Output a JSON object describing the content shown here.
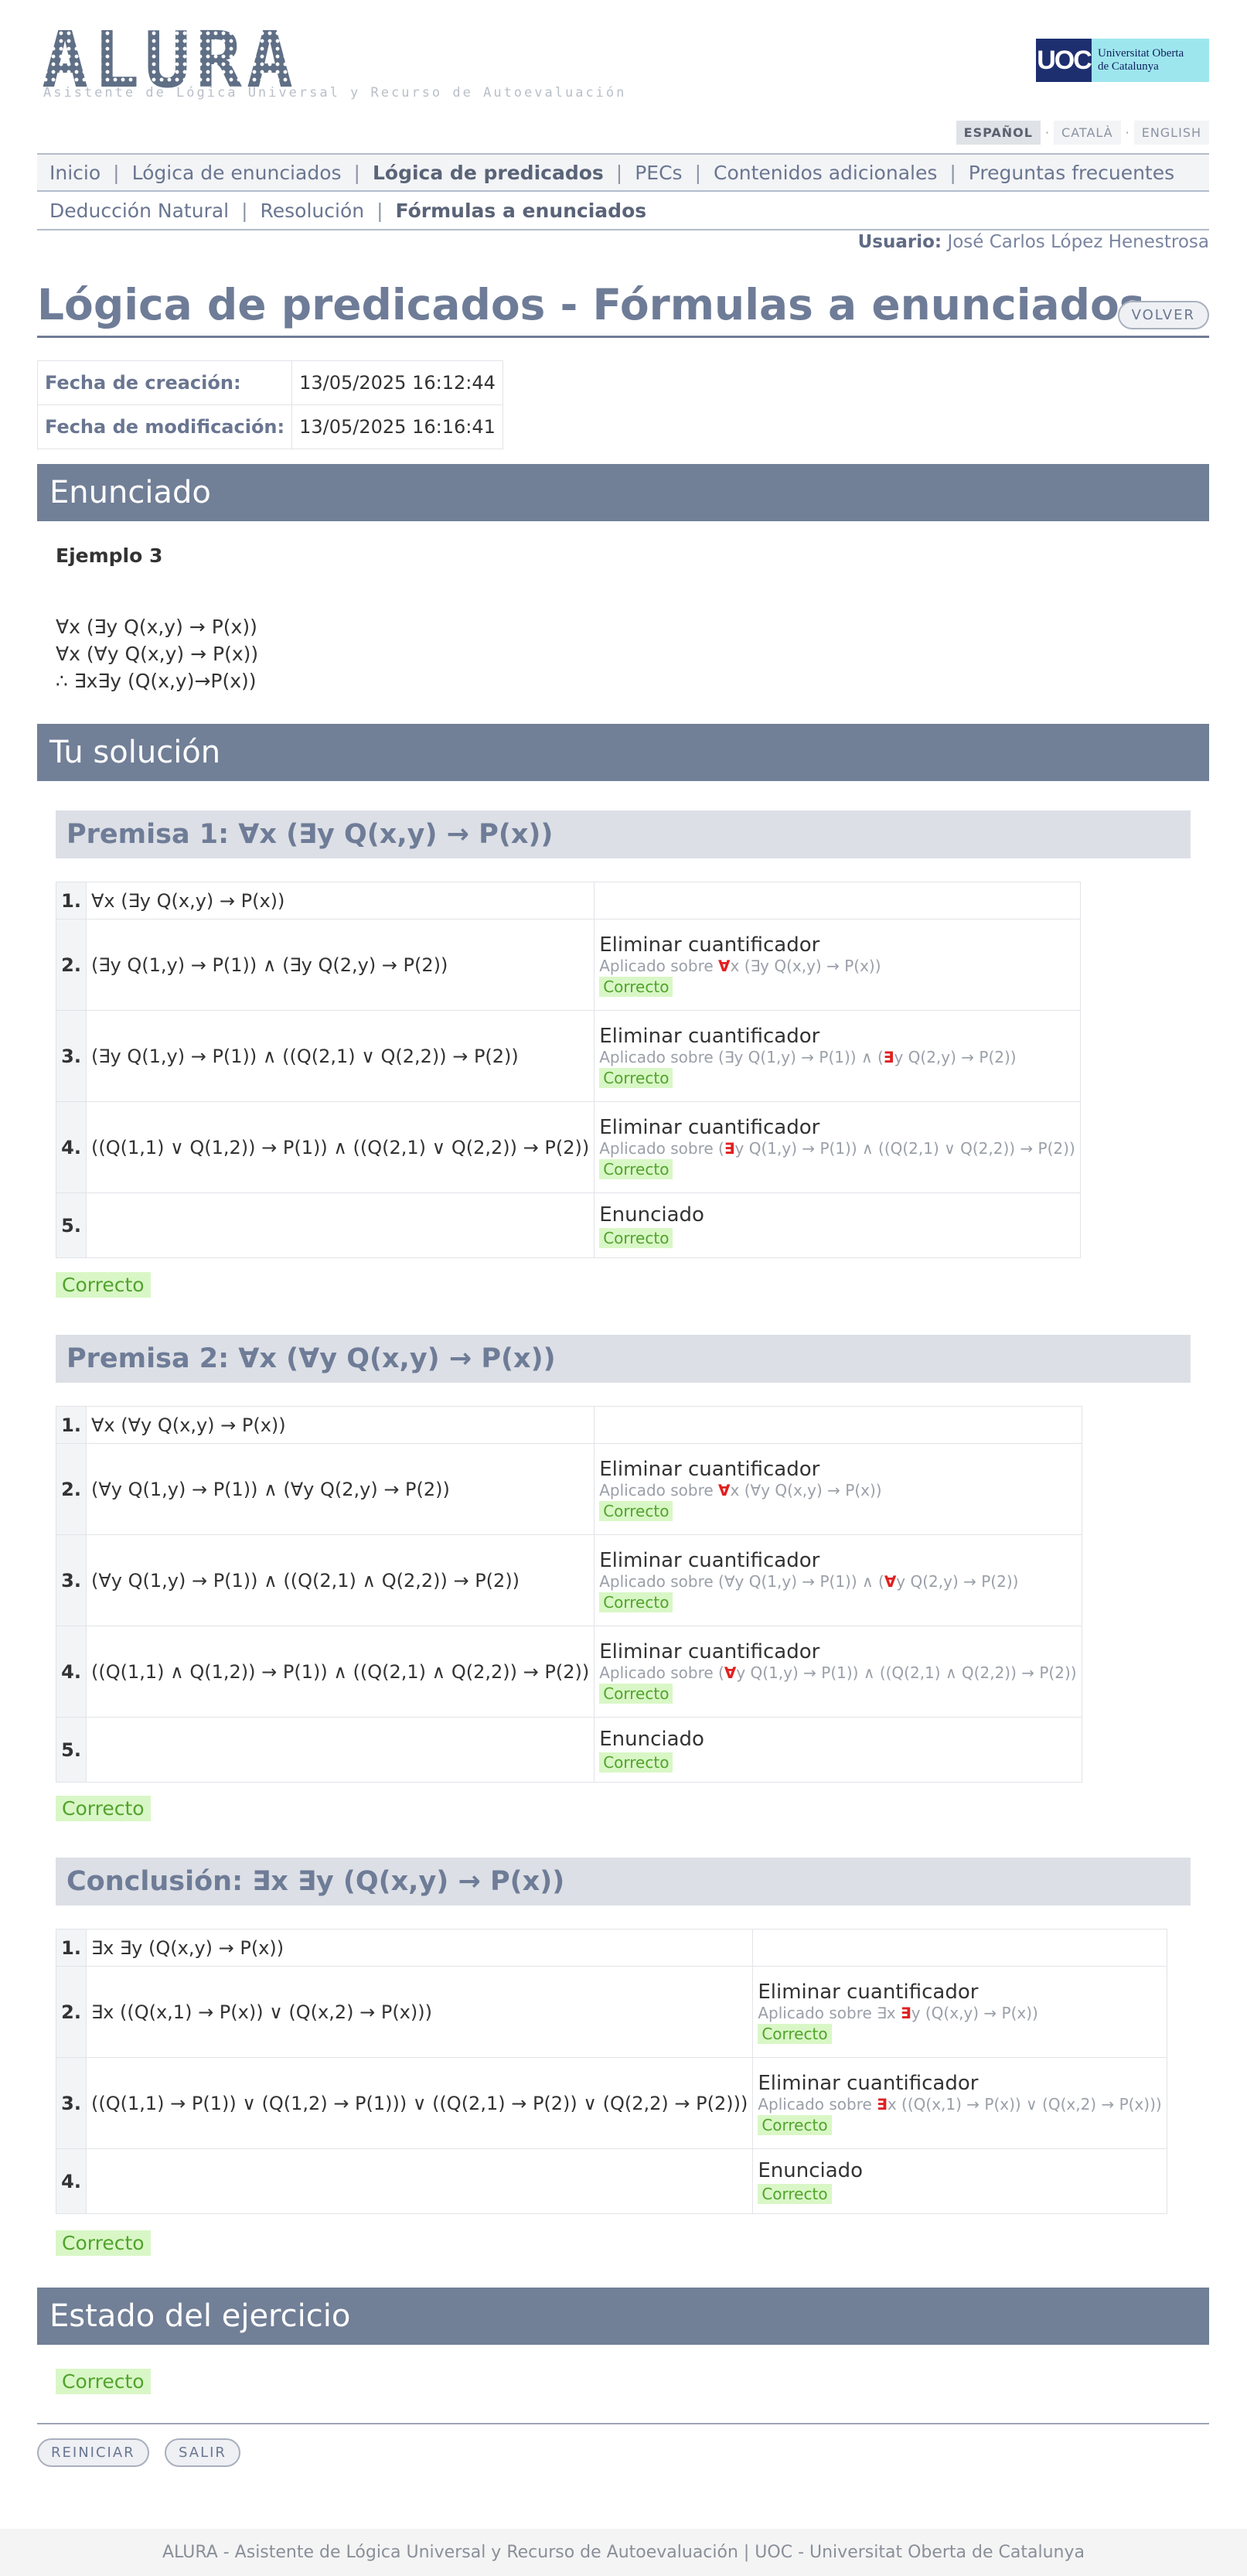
{
  "header": {
    "logo_text": "ALURA",
    "logo_subtitle": "Asistente de Lógica Universal y Recurso de Autoevaluación",
    "uoc_mark": "UOC",
    "uoc_name_line1": "Universitat Oberta",
    "uoc_name_line2": "de Catalunya",
    "languages": [
      "ESPAÑOL",
      "CATALÀ",
      "ENGLISH"
    ],
    "active_language": "ESPAÑOL"
  },
  "menu": {
    "primary": [
      "Inicio",
      "Lógica de enunciados",
      "Lógica de predicados",
      "PECs",
      "Contenidos adicionales",
      "Preguntas frecuentes"
    ],
    "primary_active": "Lógica de predicados",
    "secondary": [
      "Deducción Natural",
      "Resolución",
      "Fórmulas a enunciados"
    ],
    "secondary_active": "Fórmulas a enunciados"
  },
  "user": {
    "label": "Usuario:",
    "name": "José Carlos López Henestrosa"
  },
  "page_title": "Lógica de predicados - Fórmulas a enunciados",
  "volver_label": "VOLVER",
  "dates": {
    "created_label": "Fecha de creación:",
    "created_value": "13/05/2025 16:12:44",
    "modified_label": "Fecha de modificación:",
    "modified_value": "13/05/2025 16:16:41"
  },
  "enunciado": {
    "heading": "Enunciado",
    "example": "Ejemplo 3",
    "lines": [
      "∀x (∃y Q(x,y) → P(x))",
      "∀x (∀y Q(x,y) → P(x))",
      "∴ ∃x∃y (Q(x,y)→P(x))"
    ]
  },
  "solution_heading": "Tu solución",
  "sections": [
    {
      "title": "Premisa 1: ∀x (∃y Q(x,y) → P(x))",
      "steps": [
        {
          "n": "1.",
          "formula": "∀x (∃y Q(x,y) → P(x))"
        },
        {
          "n": "2.",
          "formula": "(∃y Q(1,y) → P(1)) ∧ (∃y Q(2,y) → P(2))",
          "rule": "Eliminar cuantificador",
          "applied_prefix": "Aplicado sobre",
          "applied_pre": "",
          "applied_hl": "∀",
          "applied_post": "x (∃y Q(x,y) → P(x))",
          "status": "Correcto"
        },
        {
          "n": "3.",
          "formula": "(∃y Q(1,y) → P(1)) ∧ ((Q(2,1) ∨ Q(2,2)) → P(2))",
          "rule": "Eliminar cuantificador",
          "applied_prefix": "Aplicado sobre",
          "applied_pre": "(∃y Q(1,y) → P(1)) ∧ (",
          "applied_hl": "∃",
          "applied_post": "y Q(2,y) → P(2))",
          "status": "Correcto"
        },
        {
          "n": "4.",
          "formula": "((Q(1,1) ∨ Q(1,2)) → P(1)) ∧ ((Q(2,1) ∨ Q(2,2)) → P(2))",
          "rule": "Eliminar cuantificador",
          "applied_prefix": "Aplicado sobre",
          "applied_pre": "(",
          "applied_hl": "∃",
          "applied_post": "y Q(1,y) → P(1)) ∧ ((Q(2,1) ∨ Q(2,2)) → P(2))",
          "status": "Correcto"
        },
        {
          "n": "5.",
          "formula": "",
          "rule": "Enunciado",
          "status": "Correcto"
        }
      ],
      "result": "Correcto"
    },
    {
      "title": "Premisa 2: ∀x (∀y Q(x,y) → P(x))",
      "steps": [
        {
          "n": "1.",
          "formula": "∀x (∀y Q(x,y) → P(x))"
        },
        {
          "n": "2.",
          "formula": "(∀y Q(1,y) → P(1)) ∧ (∀y Q(2,y) → P(2))",
          "rule": "Eliminar cuantificador",
          "applied_prefix": "Aplicado sobre",
          "applied_pre": "",
          "applied_hl": "∀",
          "applied_post": "x (∀y Q(x,y) → P(x))",
          "status": "Correcto"
        },
        {
          "n": "3.",
          "formula": "(∀y Q(1,y) → P(1)) ∧ ((Q(2,1) ∧ Q(2,2)) → P(2))",
          "rule": "Eliminar cuantificador",
          "applied_prefix": "Aplicado sobre",
          "applied_pre": "(∀y Q(1,y) → P(1)) ∧ (",
          "applied_hl": "∀",
          "applied_post": "y Q(2,y) → P(2))",
          "status": "Correcto"
        },
        {
          "n": "4.",
          "formula": "((Q(1,1) ∧ Q(1,2)) → P(1)) ∧ ((Q(2,1) ∧ Q(2,2)) → P(2))",
          "rule": "Eliminar cuantificador",
          "applied_prefix": "Aplicado sobre",
          "applied_pre": "(",
          "applied_hl": "∀",
          "applied_post": "y Q(1,y) → P(1)) ∧ ((Q(2,1) ∧ Q(2,2)) → P(2))",
          "status": "Correcto"
        },
        {
          "n": "5.",
          "formula": "",
          "rule": "Enunciado",
          "status": "Correcto"
        }
      ],
      "result": "Correcto"
    },
    {
      "title": "Conclusión: ∃x ∃y (Q(x,y) → P(x))",
      "steps": [
        {
          "n": "1.",
          "formula": "∃x ∃y (Q(x,y) → P(x))"
        },
        {
          "n": "2.",
          "formula": "∃x ((Q(x,1) → P(x)) ∨ (Q(x,2) → P(x)))",
          "rule": "Eliminar cuantificador",
          "applied_prefix": "Aplicado sobre",
          "applied_pre": "∃x ",
          "applied_hl": "∃",
          "applied_post": "y (Q(x,y) → P(x))",
          "status": "Correcto"
        },
        {
          "n": "3.",
          "formula": "((Q(1,1) → P(1)) ∨ (Q(1,2) → P(1))) ∨ ((Q(2,1) → P(2)) ∨ (Q(2,2) → P(2)))",
          "rule": "Eliminar cuantificador",
          "applied_prefix": "Aplicado sobre",
          "applied_pre": "",
          "applied_hl": "∃",
          "applied_post": "x ((Q(x,1) → P(x)) ∨ (Q(x,2) → P(x)))",
          "status": "Correcto"
        },
        {
          "n": "4.",
          "formula": "",
          "rule": "Enunciado",
          "status": "Correcto"
        }
      ],
      "result": "Correcto"
    }
  ],
  "estado": {
    "heading": "Estado del ejercicio",
    "status": "Correcto"
  },
  "buttons": {
    "reiniciar": "REINICIAR",
    "salir": "SALIR"
  },
  "footer": "ALURA - Asistente de Lógica Universal y Recurso de Autoevaluación | UOC - Universitat Oberta de Catalunya",
  "colors": {
    "bar": "#717f97",
    "ok_bg": "#d9f7c6",
    "ok_fg": "#52a32e",
    "highlight": "#e02020"
  }
}
